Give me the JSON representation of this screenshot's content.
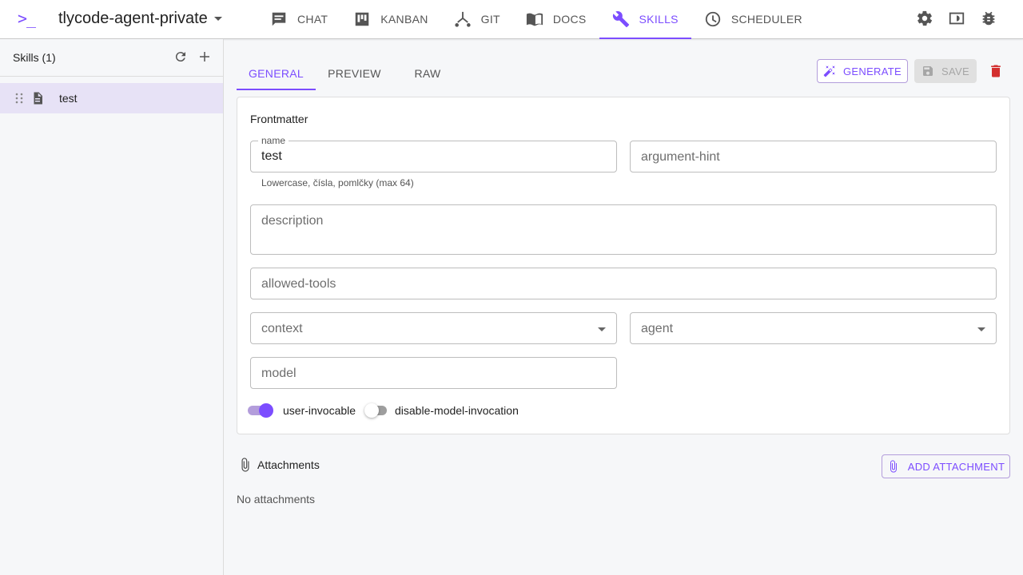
{
  "app": {
    "logo": ">_",
    "project": "tlycode-agent-private"
  },
  "nav": {
    "tabs": [
      {
        "label": "CHAT",
        "icon": "chat-icon"
      },
      {
        "label": "KANBAN",
        "icon": "kanban-icon"
      },
      {
        "label": "GIT",
        "icon": "git-icon"
      },
      {
        "label": "DOCS",
        "icon": "docs-icon"
      },
      {
        "label": "SKILLS",
        "icon": "wrench-icon",
        "active": true
      },
      {
        "label": "SCHEDULER",
        "icon": "clock-icon"
      }
    ],
    "right_icons": [
      "gear-icon",
      "panel-icon",
      "bug-icon"
    ]
  },
  "sidebar": {
    "title": "Skills (1)",
    "actions": [
      "refresh-icon",
      "add-icon"
    ],
    "items": [
      {
        "label": "test",
        "selected": true
      }
    ]
  },
  "editor": {
    "tabs": [
      "GENERAL",
      "PREVIEW",
      "RAW"
    ],
    "active_tab": "GENERAL",
    "generate_label": "GENERATE",
    "save_label": "SAVE",
    "save_disabled": true
  },
  "frontmatter": {
    "title": "Frontmatter",
    "name_label": "name",
    "name_value": "test",
    "name_hint": "Lowercase, čísla, pomlčky (max 64)",
    "argument_hint_placeholder": "argument-hint",
    "description_placeholder": "description",
    "allowed_tools_placeholder": "allowed-tools",
    "context_placeholder": "context",
    "agent_placeholder": "agent",
    "model_placeholder": "model",
    "toggles": [
      {
        "label": "user-invocable",
        "on": true
      },
      {
        "label": "disable-model-invocation",
        "on": false
      }
    ]
  },
  "attachments": {
    "title": "Attachments",
    "add_label": "ADD ATTACHMENT",
    "empty_text": "No attachments"
  },
  "colors": {
    "accent": "#7c4dff",
    "danger": "#d32f2f"
  }
}
